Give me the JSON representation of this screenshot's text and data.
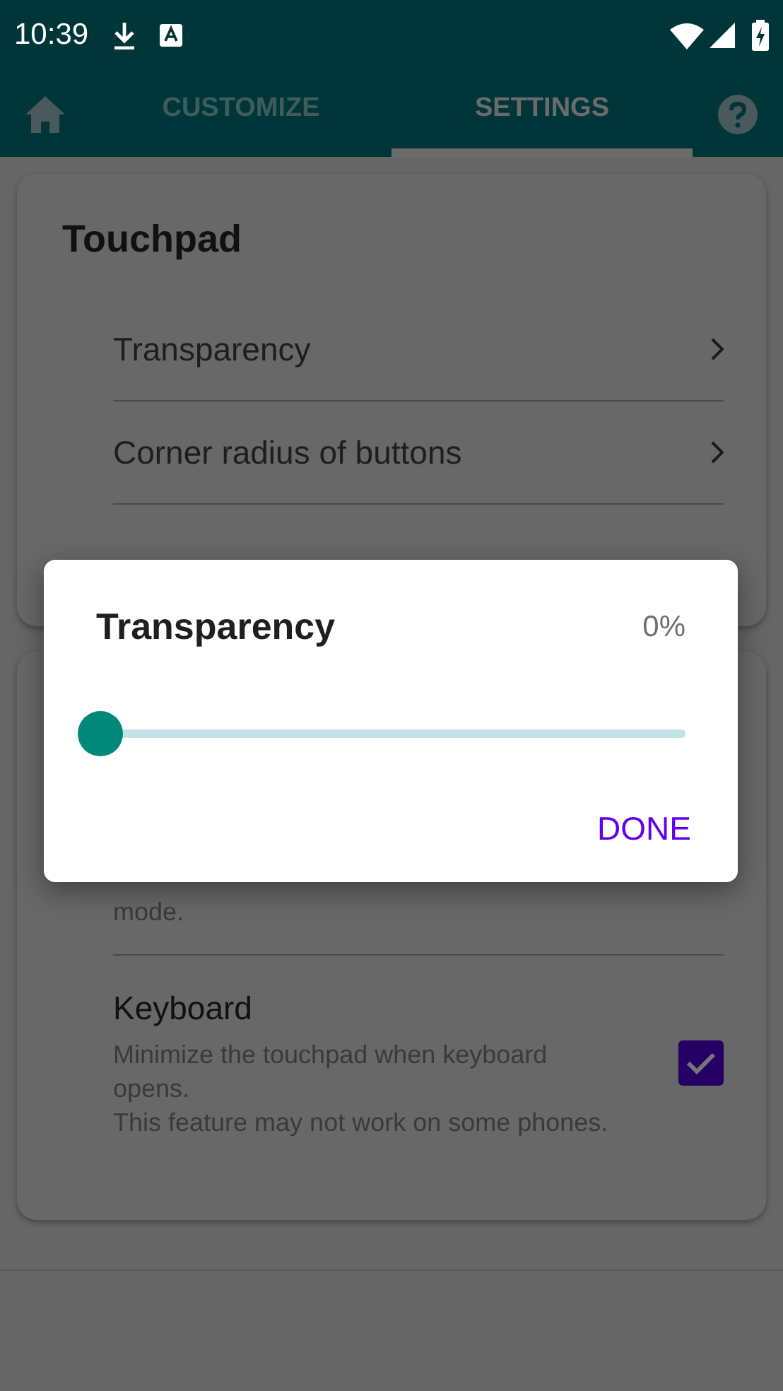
{
  "status_bar": {
    "time": "10:39"
  },
  "tabs": [
    {
      "label": "CUSTOMIZE",
      "selected": false
    },
    {
      "label": "SETTINGS",
      "selected": true
    }
  ],
  "touchpad_card": {
    "title": "Touchpad",
    "items": [
      "Transparency",
      "Corner radius of buttons"
    ]
  },
  "landscape_setting": {
    "description": "mode."
  },
  "keyboard_setting": {
    "title": "Keyboard",
    "description": "Minimize the touchpad when keyboard opens.\nThis feature may not work on some phones.",
    "checked": true
  },
  "dialog": {
    "title": "Transparency",
    "reading": "0%",
    "level": 0,
    "button": "DONE"
  }
}
